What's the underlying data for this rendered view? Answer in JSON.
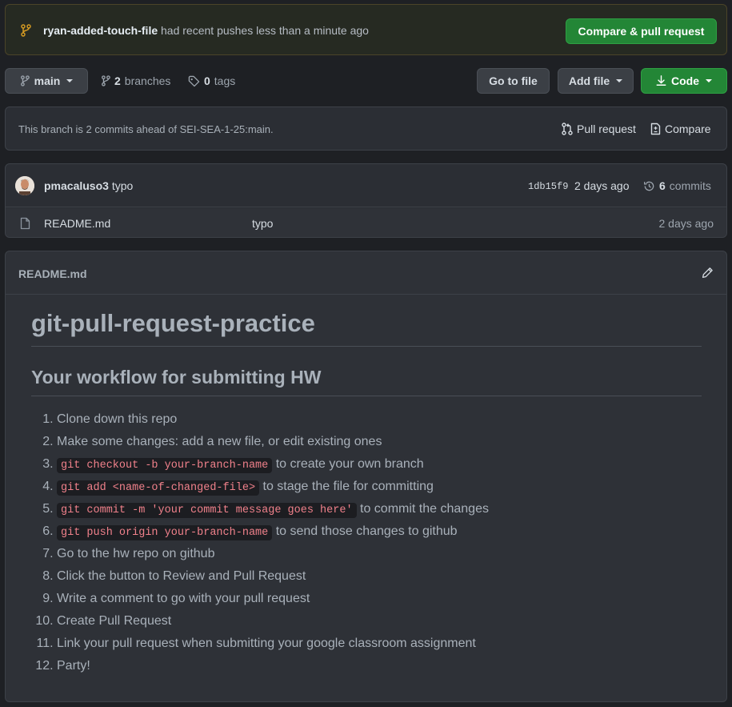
{
  "banner": {
    "branch_name": "ryan-added-touch-file",
    "message": "had recent pushes less than a minute ago",
    "compare_button": "Compare & pull request"
  },
  "nav": {
    "branch_button": "main",
    "branches_count": "2",
    "branches_label": "branches",
    "tags_count": "0",
    "tags_label": "tags",
    "go_to_file": "Go to file",
    "add_file": "Add file",
    "code": "Code"
  },
  "ahead": {
    "text": "This branch is 2 commits ahead of SEI-SEA-1-25:main.",
    "pull_request": "Pull request",
    "compare": "Compare"
  },
  "latest_commit": {
    "author": "pmacaluso3",
    "message": "typo",
    "sha": "1db15f9",
    "time": "2 days ago",
    "commits_count": "6",
    "commits_label": "commits"
  },
  "files": [
    {
      "name": "README.md",
      "message": "typo",
      "time": "2 days ago"
    }
  ],
  "readme": {
    "header": "README.md",
    "title": "git-pull-request-practice",
    "subtitle": "Your workflow for submitting HW",
    "steps": [
      {
        "text": "Clone down this repo"
      },
      {
        "text": "Make some changes: add a new file, or edit existing ones"
      },
      {
        "code": "git checkout -b your-branch-name",
        "text": " to create your own branch"
      },
      {
        "code": "git add <name-of-changed-file>",
        "text": " to stage the file for committing"
      },
      {
        "code": "git commit -m 'your commit message goes here'",
        "text": " to commit the changes"
      },
      {
        "code": "git push origin your-branch-name",
        "text": " to send those changes to github"
      },
      {
        "text": "Go to the hw repo on github"
      },
      {
        "text": "Click the button to Review and Pull Request"
      },
      {
        "text": "Write a comment to go with your pull request"
      },
      {
        "text": "Create Pull Request"
      },
      {
        "text": "Link your pull request when submitting your google classroom assignment"
      },
      {
        "text": "Party!"
      }
    ]
  },
  "colors": {
    "green": "#238636",
    "code_text": "#f0818b",
    "banner_icon": "#d29922"
  }
}
